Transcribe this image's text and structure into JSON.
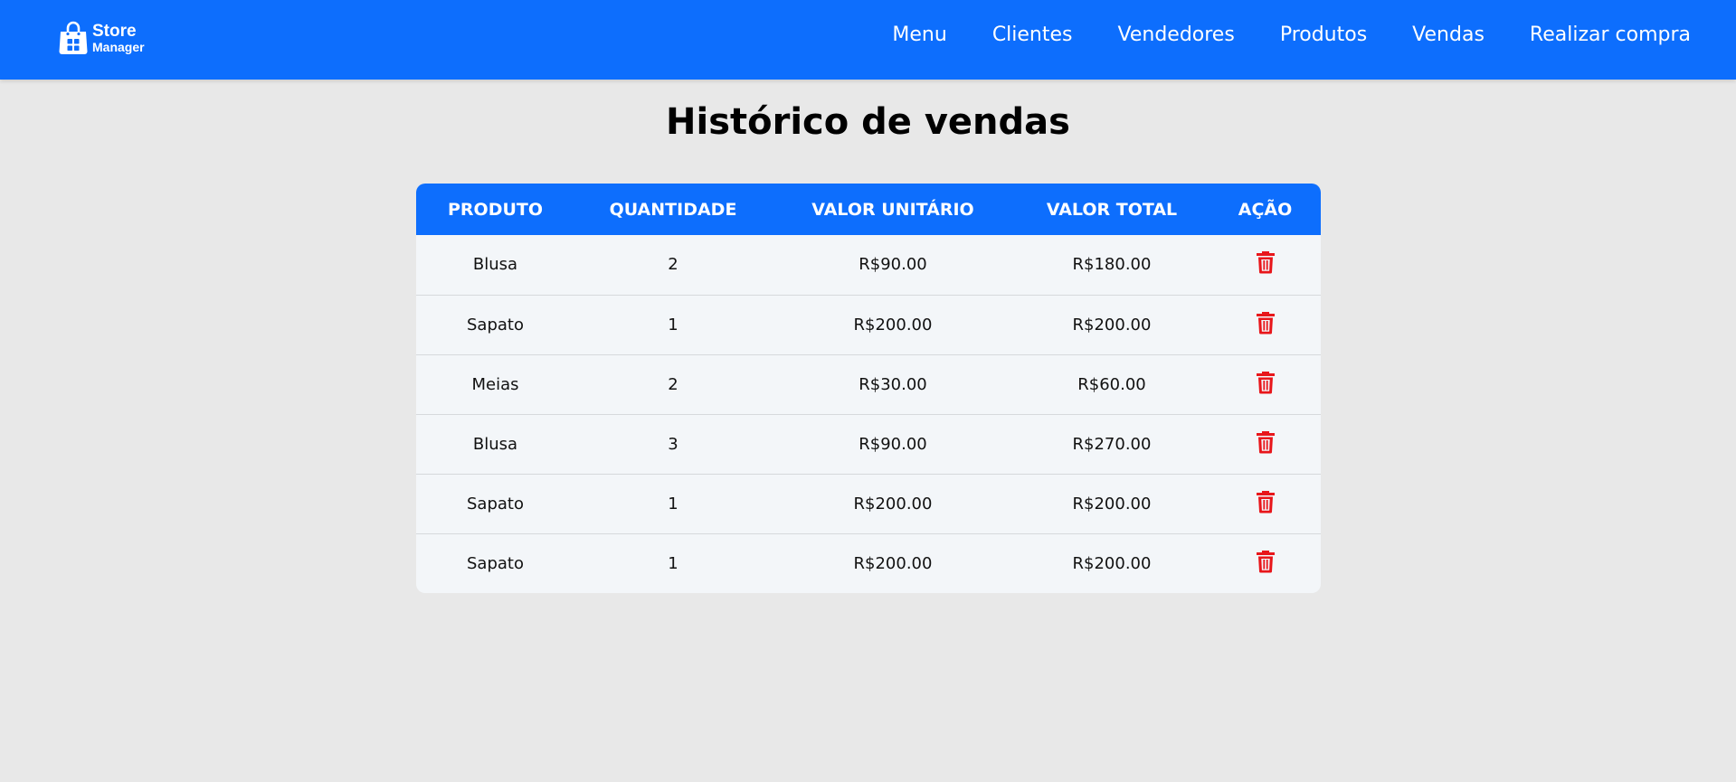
{
  "brand": {
    "name_line1": "Store",
    "name_line2": "Manager",
    "icon": "shopping-bag-icon"
  },
  "nav": {
    "items": [
      {
        "label": "Menu"
      },
      {
        "label": "Clientes"
      },
      {
        "label": "Vendedores"
      },
      {
        "label": "Produtos"
      },
      {
        "label": "Vendas"
      },
      {
        "label": "Realizar compra"
      }
    ]
  },
  "page": {
    "title": "Histórico de vendas"
  },
  "table": {
    "headers": {
      "produto": "PRODUTO",
      "quantidade": "QUANTIDADE",
      "valor_unitario": "VALOR UNITÁRIO",
      "valor_total": "VALOR TOTAL",
      "acao": "AÇÃO"
    },
    "rows": [
      {
        "produto": "Blusa",
        "quantidade": "2",
        "valor_unitario": "R$90.00",
        "valor_total": "R$180.00"
      },
      {
        "produto": "Sapato",
        "quantidade": "1",
        "valor_unitario": "R$200.00",
        "valor_total": "R$200.00"
      },
      {
        "produto": "Meias",
        "quantidade": "2",
        "valor_unitario": "R$30.00",
        "valor_total": "R$60.00"
      },
      {
        "produto": "Blusa",
        "quantidade": "3",
        "valor_unitario": "R$90.00",
        "valor_total": "R$270.00"
      },
      {
        "produto": "Sapato",
        "quantidade": "1",
        "valor_unitario": "R$200.00",
        "valor_total": "R$200.00"
      },
      {
        "produto": "Sapato",
        "quantidade": "1",
        "valor_unitario": "R$200.00",
        "valor_total": "R$200.00"
      }
    ],
    "action_icon": "trash-icon"
  },
  "colors": {
    "primary": "#0d6efd",
    "background": "#e8e8e8",
    "table_body": "#f3f6f9",
    "delete": "#e8161b"
  }
}
